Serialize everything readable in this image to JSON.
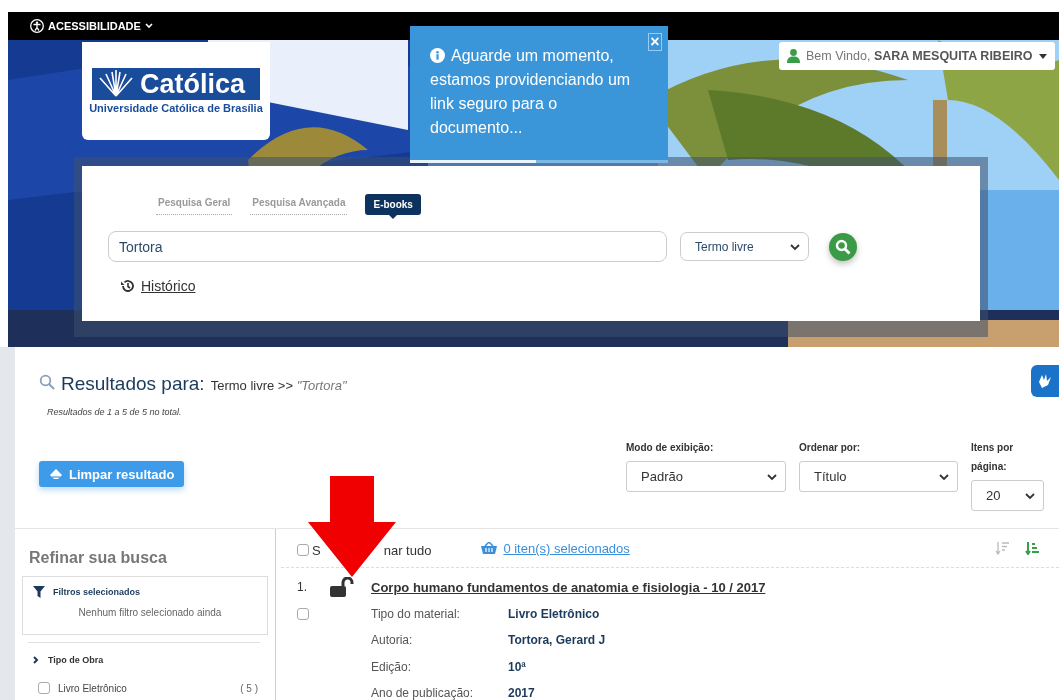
{
  "accessibility_menu": {
    "label": "ACESSIBILIDADE"
  },
  "logo": {
    "name": "Católica",
    "subtitle": "Universidade Católica de Brasília"
  },
  "toast": {
    "message": "Aguarde um momento, estamos providenciando um link seguro para o documento...",
    "close": "×",
    "level": 0.49
  },
  "user_menu": {
    "greeting": "Bem Vindo,",
    "name": "SARA MESQUITA RIBEIRO"
  },
  "search": {
    "tabs": [
      {
        "label": "Pesquisa Geral",
        "selected": false
      },
      {
        "label": "Pesquisa Avançada",
        "selected": false
      },
      {
        "label": "E-books",
        "selected": true
      }
    ],
    "query": "Tortora",
    "field_select": "Termo livre",
    "history_link": "Histórico"
  },
  "results": {
    "title": "Resultados para:",
    "criteria": "Termo livre >>",
    "term": "\"Tortora\"",
    "count_text": "Resultados de 1 a 5 de 5 no total.",
    "clear_button": "Limpar resultado",
    "controls": [
      {
        "label": "Modo de exibição:",
        "value": "Padrão"
      },
      {
        "label": "Ordenar por:",
        "value": "Título"
      },
      {
        "label": "Itens por página:",
        "value": "20"
      }
    ]
  },
  "sidebar": {
    "title": "Refinar sua busca",
    "filters_title": "Filtros selecionados",
    "filters_empty": "Nenhum filtro selecionado ainda",
    "facets": [
      {
        "label": "Tipo de Obra",
        "expanded": false,
        "options": [
          {
            "label": "Livro Eletrônico",
            "count": "( 5 )",
            "checked": false
          }
        ]
      }
    ]
  },
  "list": {
    "select_all": {
      "label_parts": [
        "S",
        "nar tudo"
      ],
      "checked": false
    },
    "basket_link": "0 iten(s) selecionados",
    "sort_buttons": [
      {
        "kind": "descending",
        "selected": false
      },
      {
        "kind": "ascending",
        "selected": true
      }
    ],
    "items": [
      {
        "number": "1.",
        "open_access": true,
        "checked": false,
        "title": "Corpo humano fundamentos de anatomia e fisiologia - 10 / 2017",
        "fields": [
          {
            "label": "Tipo do material:",
            "value": "Livro Eletrônico"
          },
          {
            "label": "Autoria:",
            "value": "Tortora, Gerard J"
          },
          {
            "label": "Edição:",
            "value": "10ª"
          },
          {
            "label": "Ano de publicação:",
            "value": "2017"
          }
        ]
      }
    ]
  }
}
